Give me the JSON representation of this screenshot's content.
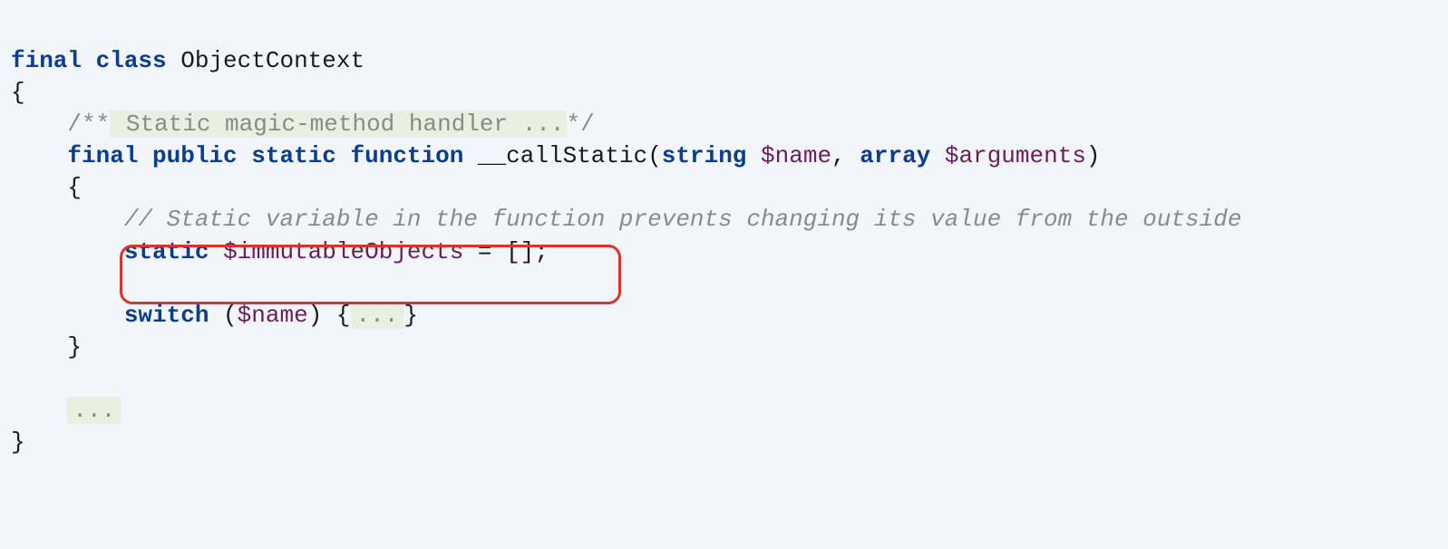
{
  "code": {
    "l1_kw_final": "final",
    "l1_kw_class": "class",
    "l1_classname": "ObjectContext",
    "l2_brace": "{",
    "l3_doc_open": "/**",
    "l3_doc_text": " Static magic-method handler ...",
    "l3_doc_close": "*/",
    "l4_kw_final": "final",
    "l4_kw_public": "public",
    "l4_kw_static": "static",
    "l4_kw_function": "function",
    "l4_method": "__callStatic",
    "l4_paren_open": "(",
    "l4_kw_string": "string",
    "l4_var_name": "$name",
    "l4_comma": ", ",
    "l4_kw_array": "array",
    "l4_var_args": "$arguments",
    "l4_paren_close": ")",
    "l5_brace": "{",
    "l6_comment": "// Static variable in the function prevents changing its value from the outside",
    "l7_kw_static": "static",
    "l7_var": "$immutableObjects",
    "l7_assign": " = [];",
    "l8_kw_switch": "switch",
    "l8_paren_open": " (",
    "l8_var": "$name",
    "l8_paren_close": ") ",
    "l8_brace_open": "{",
    "l8_fold": "...",
    "l8_brace_close": "}",
    "l9_brace": "}",
    "l10_fold": "...",
    "l11_brace": "}"
  }
}
